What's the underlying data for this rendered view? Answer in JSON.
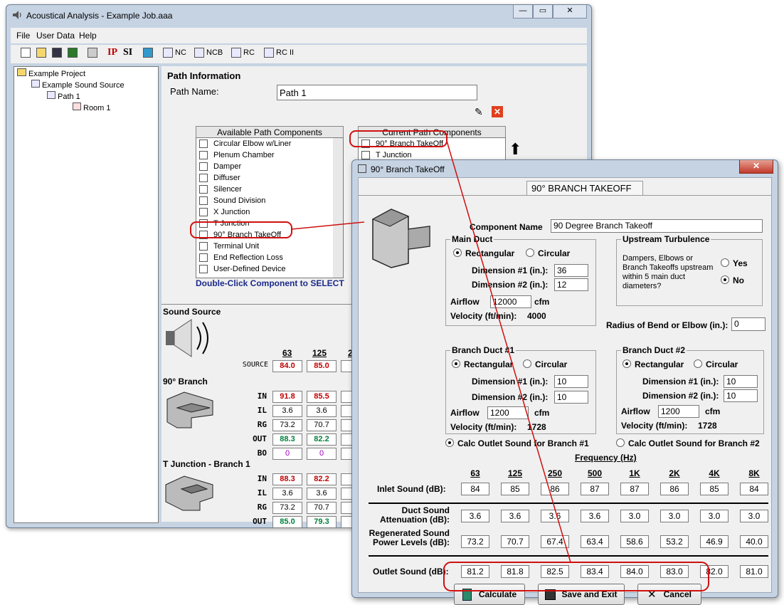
{
  "main_window": {
    "title": "Acoustical Analysis - Example Job.aaa",
    "menu": [
      "File",
      "User Data",
      "Help"
    ],
    "toolbar": {
      "ip": "IP",
      "si": "SI",
      "nc": "NC",
      "ncb": "NCB",
      "rc": "RC",
      "rc2": "RC II"
    },
    "tree": {
      "project": "Example Project",
      "source": "Example Sound Source",
      "path": "Path 1",
      "room": "Room 1"
    },
    "path_info": {
      "heading": "Path Information",
      "name_label": "Path Name:",
      "name_value": "Path 1"
    },
    "available": {
      "heading": "Available Path Components",
      "items": [
        "Circular Elbow w/Liner",
        "Plenum Chamber",
        "Damper",
        "Diffuser",
        "Silencer",
        "Sound Division",
        "X Junction",
        "T Junction",
        "90° Branch TakeOff",
        "Terminal Unit",
        "End Reflection Loss",
        "User-Defined Device"
      ],
      "hint": "Double-Click Component to SELECT"
    },
    "current": {
      "heading": "Current Path Components",
      "items": [
        "90° Branch TakeOff",
        "T Junction"
      ]
    },
    "sound_source": {
      "heading": "Sound Source",
      "freqs": [
        "63",
        "125",
        "2"
      ],
      "source_label": "SOURCE",
      "source_values": [
        "84.0",
        "85.0",
        "8"
      ]
    },
    "branch": {
      "heading": "90° Branch",
      "rows": [
        {
          "label": "IN",
          "values": [
            "91.8",
            "85.5",
            "7"
          ],
          "style": "red"
        },
        {
          "label": "IL",
          "values": [
            "3.6",
            "3.6",
            "3"
          ],
          "style": "plain"
        },
        {
          "label": "RG",
          "values": [
            "73.2",
            "70.7",
            "6"
          ],
          "style": "plain"
        },
        {
          "label": "OUT",
          "values": [
            "88.3",
            "82.2",
            "7"
          ],
          "style": "green"
        },
        {
          "label": "BO",
          "values": [
            "0",
            "0",
            ""
          ],
          "style": "purple"
        }
      ]
    },
    "tjunction": {
      "heading": "T Junction - Branch 1",
      "rows": [
        {
          "label": "IN",
          "values": [
            "88.3",
            "82.2",
            "7"
          ],
          "style": "red"
        },
        {
          "label": "IL",
          "values": [
            "3.6",
            "3.6",
            "3"
          ],
          "style": "plain"
        },
        {
          "label": "RG",
          "values": [
            "73.2",
            "70.7",
            "6"
          ],
          "style": "plain"
        },
        {
          "label": "OUT",
          "values": [
            "85.0",
            "79.3",
            "7"
          ],
          "style": "green"
        }
      ]
    }
  },
  "dialog": {
    "title": "90° Branch TakeOff",
    "tab": "90° BRANCH TAKEOFF",
    "component_name_label": "Component Name",
    "component_name_value": "90 Degree Branch Takeoff",
    "main_duct": {
      "heading": "Main Duct",
      "rect": "Rectangular",
      "circ": "Circular",
      "dim1_label": "Dimension #1 (in.):",
      "dim1": "36",
      "dim2_label": "Dimension #2 (in.):",
      "dim2": "12",
      "airflow_label": "Airflow",
      "airflow": "12000",
      "cfm": "cfm",
      "velocity_label": "Velocity (ft/min):",
      "velocity": "4000"
    },
    "upstream": {
      "heading": "Upstream Turbulence",
      "text": "Dampers, Elbows or Branch Takeoffs upstream within 5 main duct diameters?",
      "yes": "Yes",
      "no": "No"
    },
    "radius_label": "Radius of Bend or Elbow (in.):",
    "radius_value": "0",
    "branch1": {
      "heading": "Branch Duct #1",
      "rect": "Rectangular",
      "circ": "Circular",
      "dim1_label": "Dimension #1 (in.):",
      "dim1": "10",
      "dim2_label": "Dimension #2 (in.):",
      "dim2": "10",
      "airflow_label": "Airflow",
      "airflow": "1200",
      "cfm": "cfm",
      "velocity_label": "Velocity (ft/min):",
      "velocity": "1728",
      "calc_label": "Calc Outlet Sound for Branch #1"
    },
    "branch2": {
      "heading": "Branch Duct #2",
      "rect": "Rectangular",
      "circ": "Circular",
      "dim1_label": "Dimension #1 (in.):",
      "dim1": "10",
      "dim2_label": "Dimension #2 (in.):",
      "dim2": "10",
      "airflow_label": "Airflow",
      "airflow": "1200",
      "cfm": "cfm",
      "velocity_label": "Velocity (ft/min):",
      "velocity": "1728",
      "calc_label": "Calc Outlet Sound for Branch #2"
    },
    "freq_heading": "Frequency (Hz)",
    "freqs": [
      "63",
      "125",
      "250",
      "500",
      "1K",
      "2K",
      "4K",
      "8K"
    ],
    "inlet_label": "Inlet Sound (dB):",
    "inlet": [
      "84",
      "85",
      "86",
      "87",
      "87",
      "86",
      "85",
      "84"
    ],
    "atten_label1": "Duct Sound",
    "atten_label2": "Attenuation (dB):",
    "atten": [
      "3.6",
      "3.6",
      "3.6",
      "3.6",
      "3.0",
      "3.0",
      "3.0",
      "3.0"
    ],
    "regen_label1": "Regenerated Sound",
    "regen_label2": "Power Levels (dB):",
    "regen": [
      "73.2",
      "70.7",
      "67.4",
      "63.4",
      "58.6",
      "53.2",
      "46.9",
      "40.0"
    ],
    "outlet_label": "Outlet Sound (dB):",
    "outlet": [
      "81.2",
      "81.8",
      "82.5",
      "83.4",
      "84.0",
      "83.0",
      "82.0",
      "81.0"
    ],
    "buttons": {
      "calculate": "Calculate",
      "save": "Save and Exit",
      "cancel": "Cancel"
    }
  }
}
